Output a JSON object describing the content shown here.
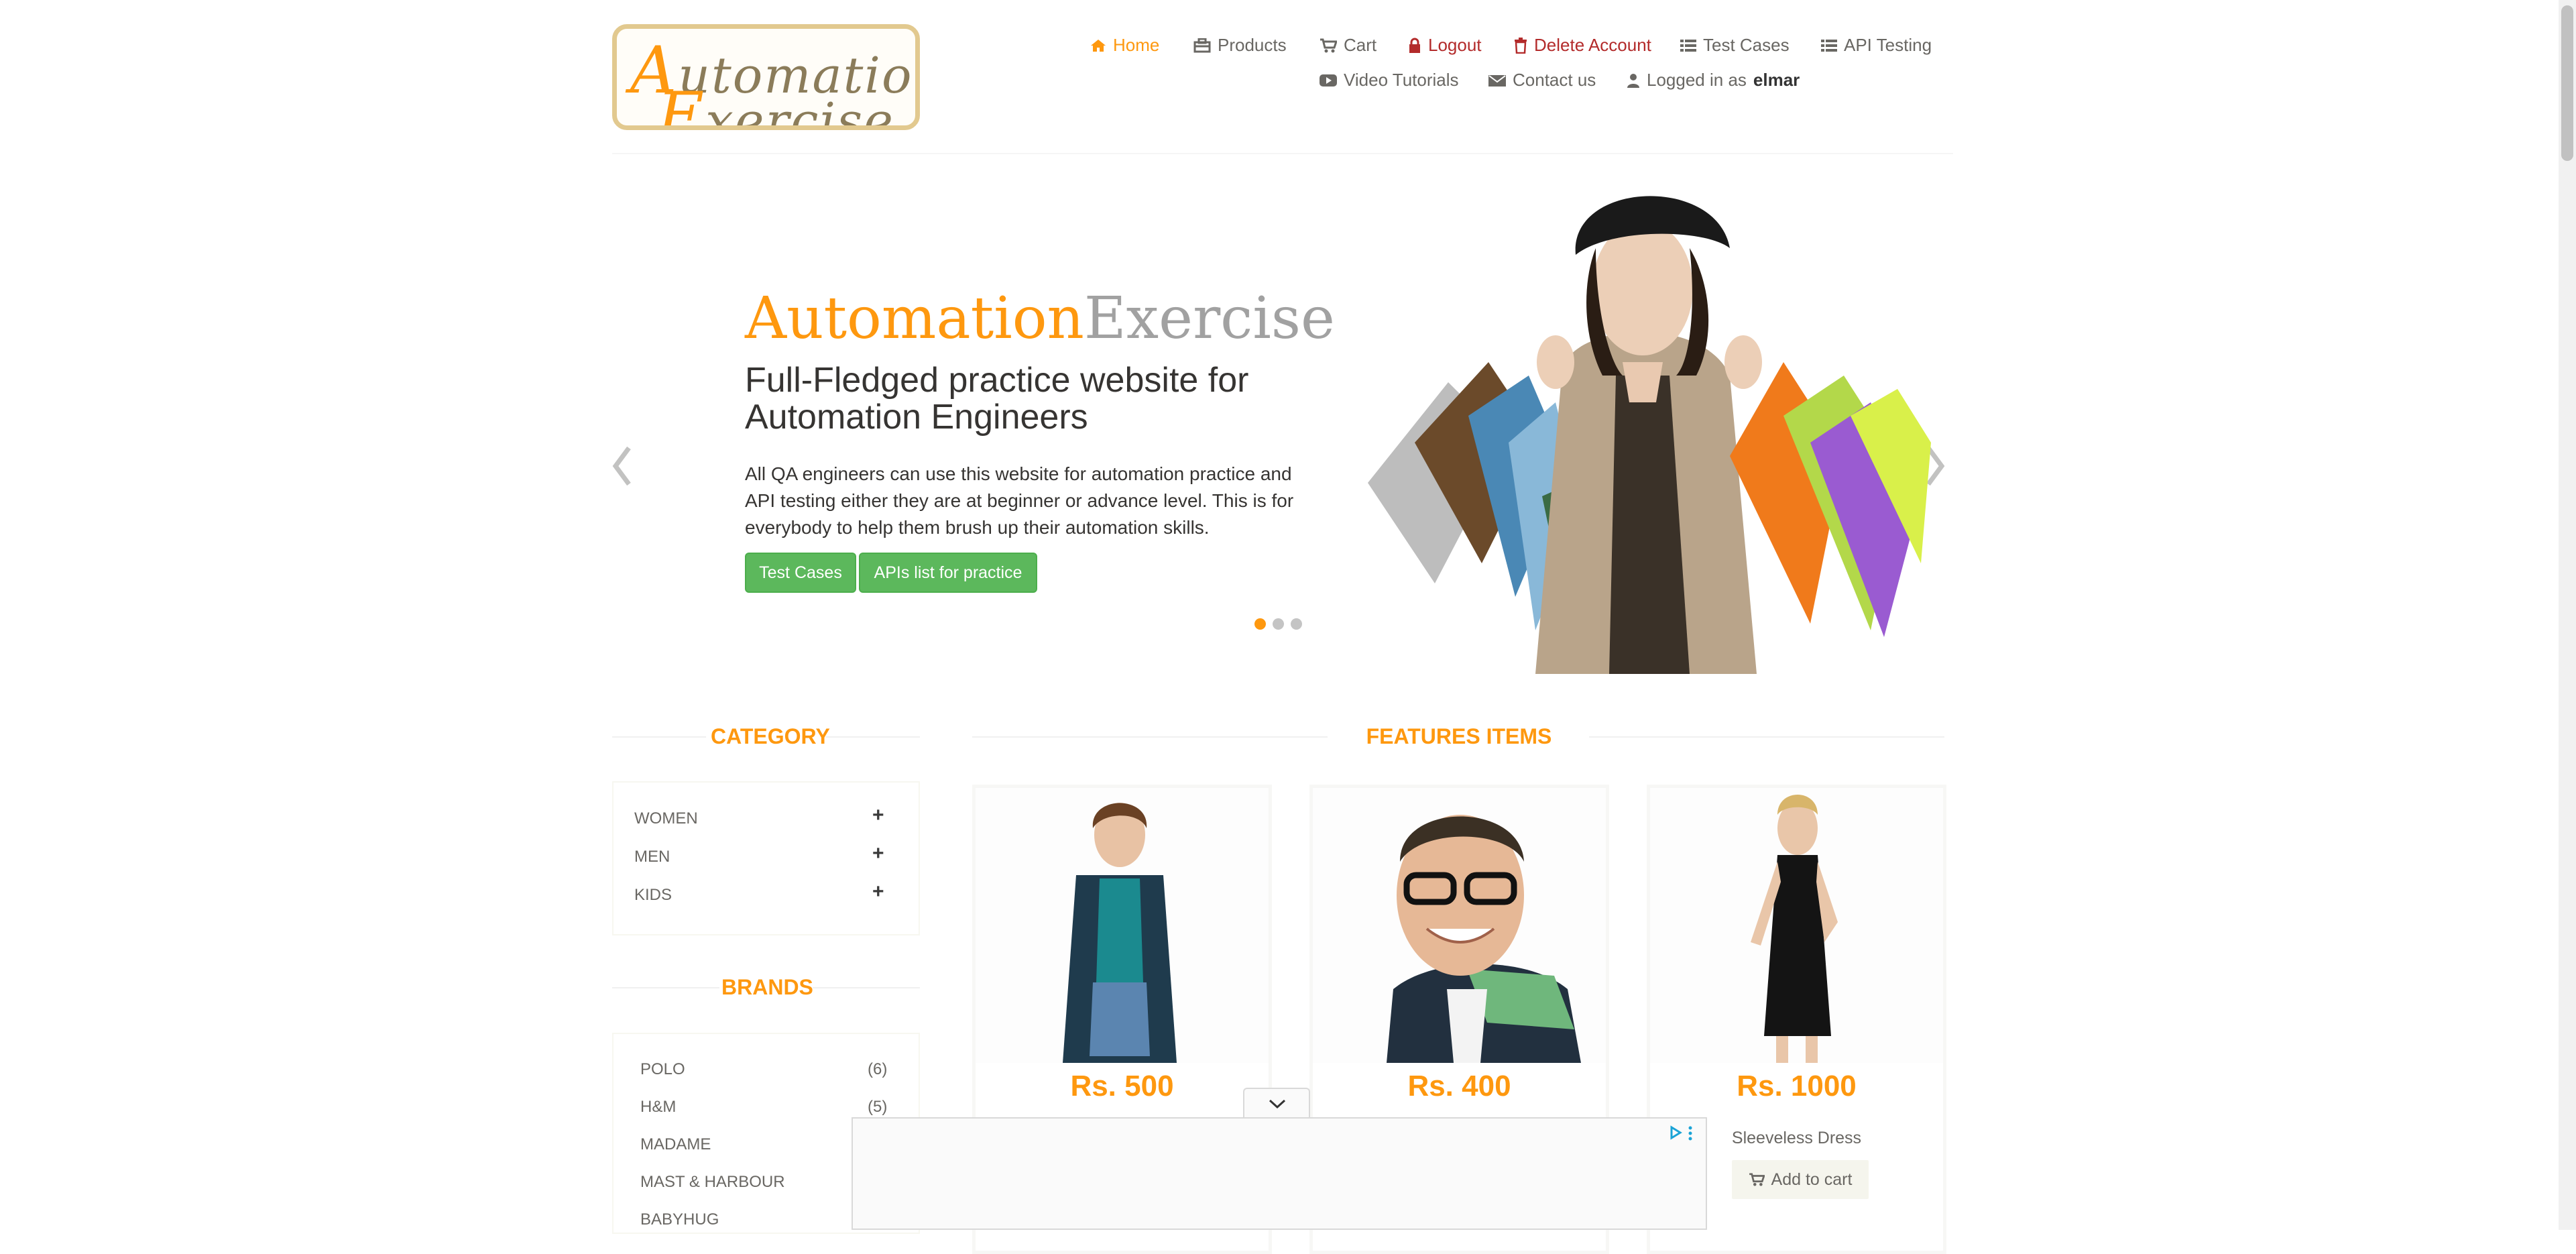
{
  "logo": {
    "line1": "Automation",
    "line2": "Exercise",
    "line1_first": "A",
    "line1_rest": "utomation",
    "line2_first": "E",
    "line2_rest": "xercise"
  },
  "nav": {
    "home": "Home",
    "products": "Products",
    "cart": "Cart",
    "logout": "Logout",
    "delete_account": "Delete Account",
    "test_cases": "Test Cases",
    "api_testing": "API Testing",
    "video_tutorials": "Video Tutorials",
    "contact_us": "Contact us",
    "logged_in_prefix": "Logged in as",
    "logged_in_user": "elmar"
  },
  "hero": {
    "title_part1": "Automation",
    "title_part2": "Exercise",
    "subtitle": "Full-Fledged practice website for Automation Engineers",
    "description": "All QA engineers can use this website for automation practice and API testing either they are at beginner or advance level. This is for everybody to help them brush up their automation skills.",
    "btn_test_cases": "Test Cases",
    "btn_apis": "APIs list for practice",
    "slide_count": 3,
    "active_slide": 1
  },
  "category": {
    "title": "CATEGORY",
    "items": [
      {
        "label": "WOMEN"
      },
      {
        "label": "MEN"
      },
      {
        "label": "KIDS"
      }
    ]
  },
  "brands": {
    "title": "BRANDS",
    "items": [
      {
        "name": "POLO",
        "count": "(6)"
      },
      {
        "name": "H&M",
        "count": "(5)"
      },
      {
        "name": "MADAME",
        "count": ""
      },
      {
        "name": "MAST & HARBOUR",
        "count": ""
      },
      {
        "name": "BABYHUG",
        "count": ""
      }
    ]
  },
  "features": {
    "title": "FEATURES ITEMS",
    "products": [
      {
        "price": "Rs. 500",
        "name": ""
      },
      {
        "price": "Rs. 400",
        "name": ""
      },
      {
        "price": "Rs. 1000",
        "name": "Sleeveless Dress",
        "add_to_cart": "Add to cart"
      }
    ]
  },
  "colors": {
    "accent": "#fe980f",
    "green": "#5cb85c",
    "danger": "#b32b2b"
  }
}
